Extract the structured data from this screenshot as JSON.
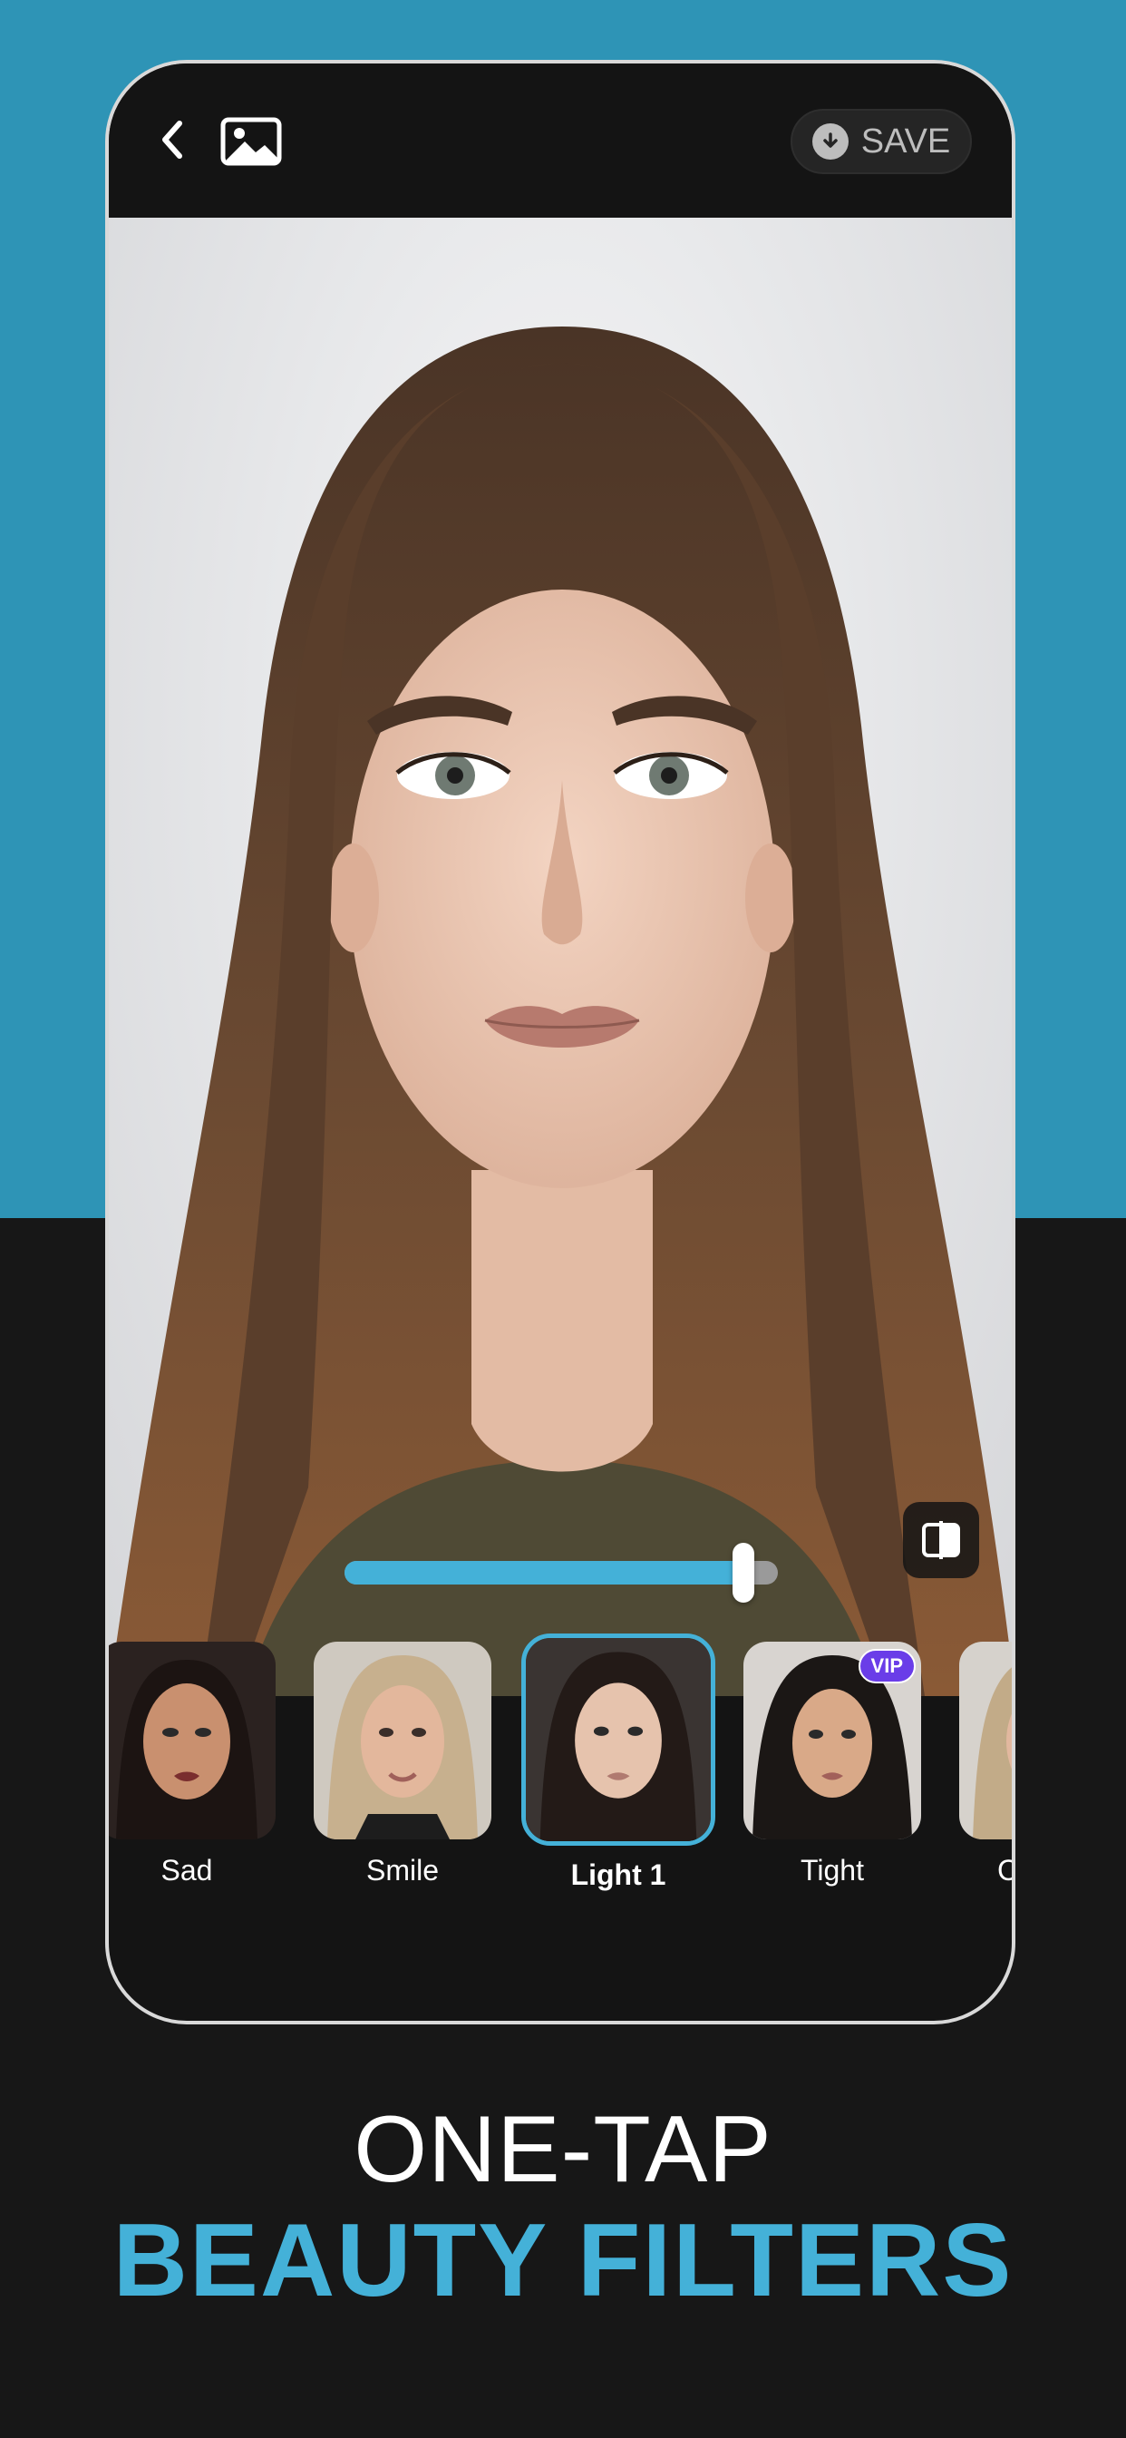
{
  "colors": {
    "brand_blue": "#2e94b6",
    "accent": "#44b1d8",
    "dark": "#171717",
    "vip_purple": "#6a3de8"
  },
  "toolbar": {
    "back_icon": "chevron-left-icon",
    "gallery_icon": "image-icon",
    "save_icon": "download-icon",
    "save_label": "SAVE"
  },
  "editor": {
    "intensity": 0.92,
    "compare_icon": "compare-split-icon"
  },
  "filters": [
    {
      "label": "Sad",
      "selected": false,
      "vip": false
    },
    {
      "label": "Smile",
      "selected": false,
      "vip": false
    },
    {
      "label": "Light 1",
      "selected": true,
      "vip": false
    },
    {
      "label": "Tight",
      "selected": false,
      "vip": true,
      "badge": "VIP"
    },
    {
      "label": "C",
      "selected": false,
      "vip": false
    }
  ],
  "headline": {
    "line1": "ONE-TAP",
    "line2": "BEAUTY FILTERS"
  }
}
